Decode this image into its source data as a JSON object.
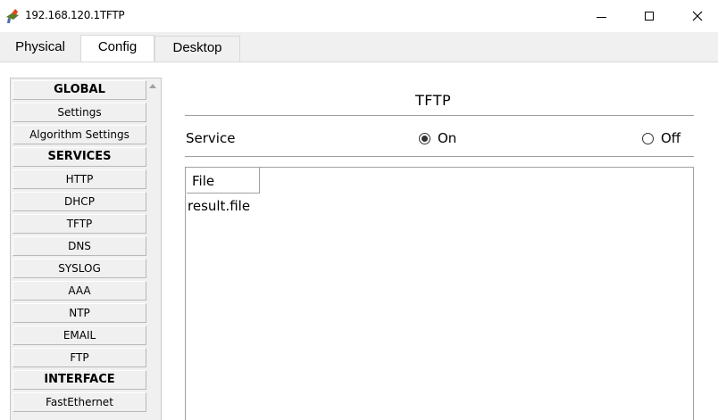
{
  "window": {
    "title": "192.168.120.1TFTP",
    "controls": {
      "minimize": "minimize",
      "maximize": "maximize",
      "close": "✕"
    }
  },
  "tabs": [
    {
      "label": "Physical",
      "active": false
    },
    {
      "label": "Config",
      "active": true
    },
    {
      "label": "Desktop",
      "active": false
    }
  ],
  "sidebar": {
    "items": [
      {
        "label": "GLOBAL",
        "header": true
      },
      {
        "label": "Settings",
        "header": false
      },
      {
        "label": "Algorithm Settings",
        "header": false
      },
      {
        "label": "SERVICES",
        "header": true
      },
      {
        "label": "HTTP",
        "header": false
      },
      {
        "label": "DHCP",
        "header": false
      },
      {
        "label": "TFTP",
        "header": false
      },
      {
        "label": "DNS",
        "header": false
      },
      {
        "label": "SYSLOG",
        "header": false
      },
      {
        "label": "AAA",
        "header": false
      },
      {
        "label": "NTP",
        "header": false
      },
      {
        "label": "EMAIL",
        "header": false
      },
      {
        "label": "FTP",
        "header": false
      },
      {
        "label": "INTERFACE",
        "header": true
      },
      {
        "label": "FastEthernet",
        "header": false
      }
    ]
  },
  "main": {
    "title": "TFTP",
    "service": {
      "label": "Service",
      "on_label": "On",
      "off_label": "Off",
      "selected": "On"
    },
    "files": {
      "column_header": "File",
      "rows": [
        "result.file"
      ]
    }
  },
  "icons": {
    "app": "packet-tracer-server-icon"
  }
}
